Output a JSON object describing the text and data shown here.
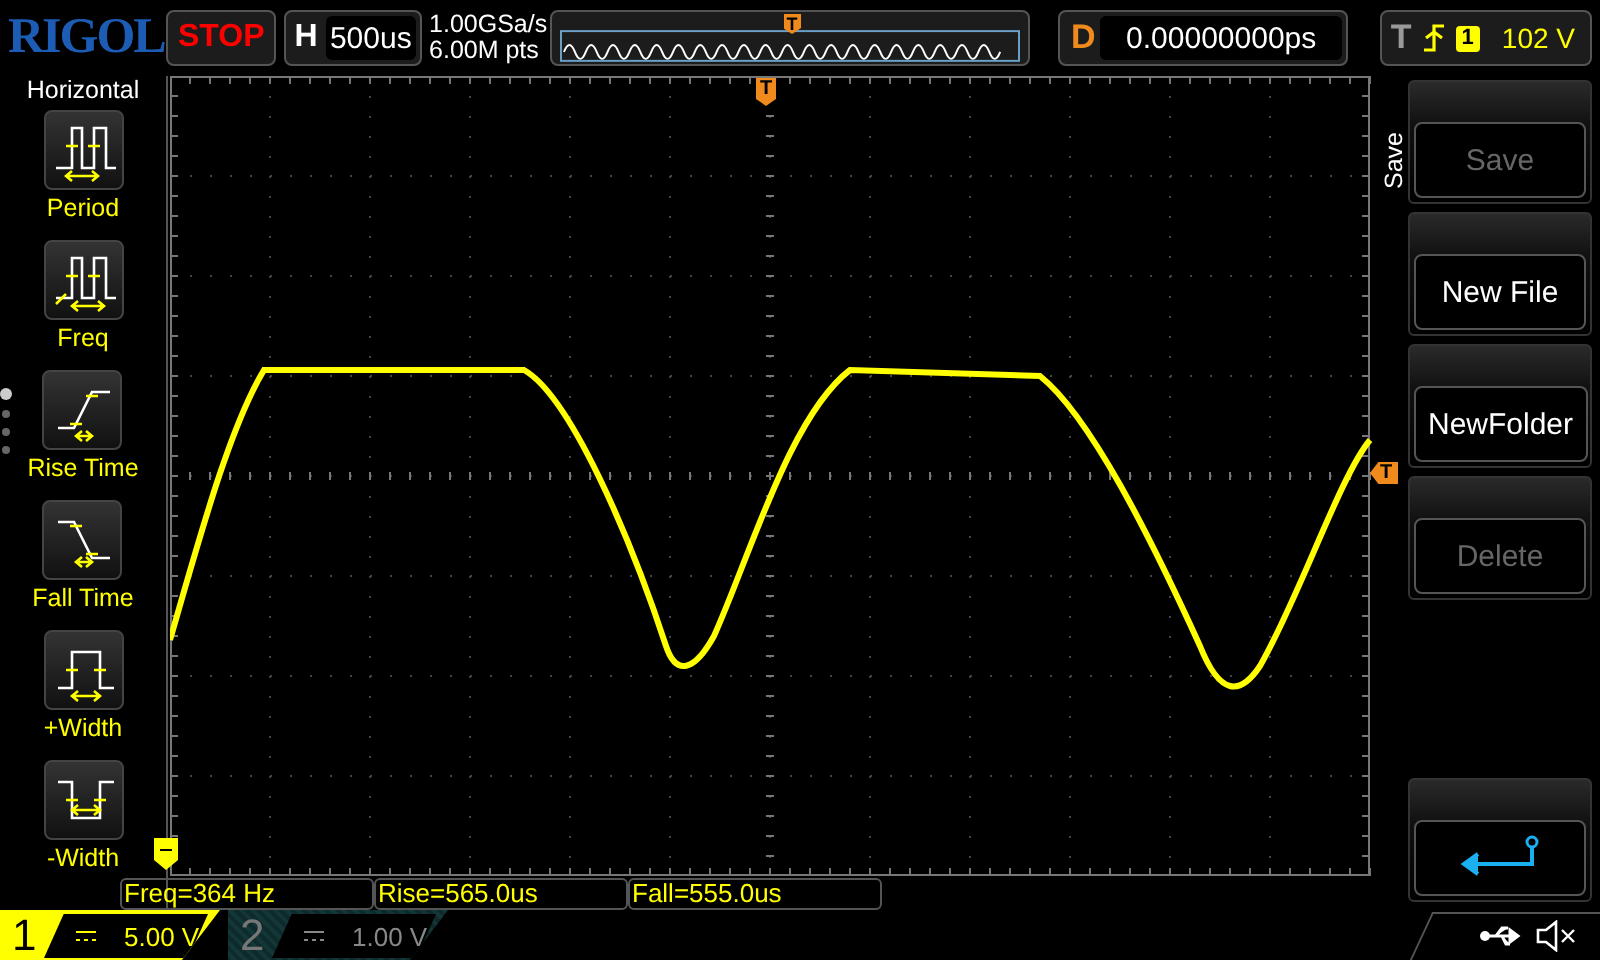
{
  "top_bar": {
    "logo": "RIGOL",
    "run_state": "STOP",
    "horizontal": {
      "label": "H",
      "value": "500us"
    },
    "sample_rate": "1.00GSa/s",
    "memory_depth": "6.00M pts",
    "overview_marker": "T",
    "delay": {
      "label": "D",
      "value": "0.00000000ps"
    },
    "trigger": {
      "label": "T",
      "channel": "1",
      "level": "102 V"
    }
  },
  "left_menu": {
    "title": "Horizontal",
    "items": [
      {
        "kind": "period",
        "label": "Period"
      },
      {
        "kind": "freq",
        "label": "Freq"
      },
      {
        "kind": "rise",
        "label": "Rise Time"
      },
      {
        "kind": "fall",
        "label": "Fall Time"
      },
      {
        "kind": "pwidth",
        "label": "+Width"
      },
      {
        "kind": "nwidth",
        "label": "-Width"
      }
    ],
    "pages": [
      {
        "selected": true
      },
      {
        "selected": false
      },
      {
        "selected": false
      },
      {
        "selected": false
      }
    ]
  },
  "screen": {
    "trigger_position_marker": "T",
    "trigger_level_marker": "T"
  },
  "right_menu": {
    "title": "Save",
    "buttons": [
      {
        "kind": "text",
        "label": "Save",
        "disabled": true
      },
      {
        "kind": "text",
        "label": "New File",
        "disabled": false
      },
      {
        "kind": "text",
        "label": "NewFolder",
        "disabled": false
      },
      {
        "kind": "text",
        "label": "Delete",
        "disabled": true
      },
      {
        "kind": "back"
      }
    ]
  },
  "measurements": [
    "Freq=364 Hz",
    "Rise=565.0us",
    "Fall=555.0us"
  ],
  "channels": [
    {
      "number": "1",
      "scale": "5.00 V",
      "on": true
    },
    {
      "number": "2",
      "scale": "1.00 V",
      "on": false
    }
  ]
}
